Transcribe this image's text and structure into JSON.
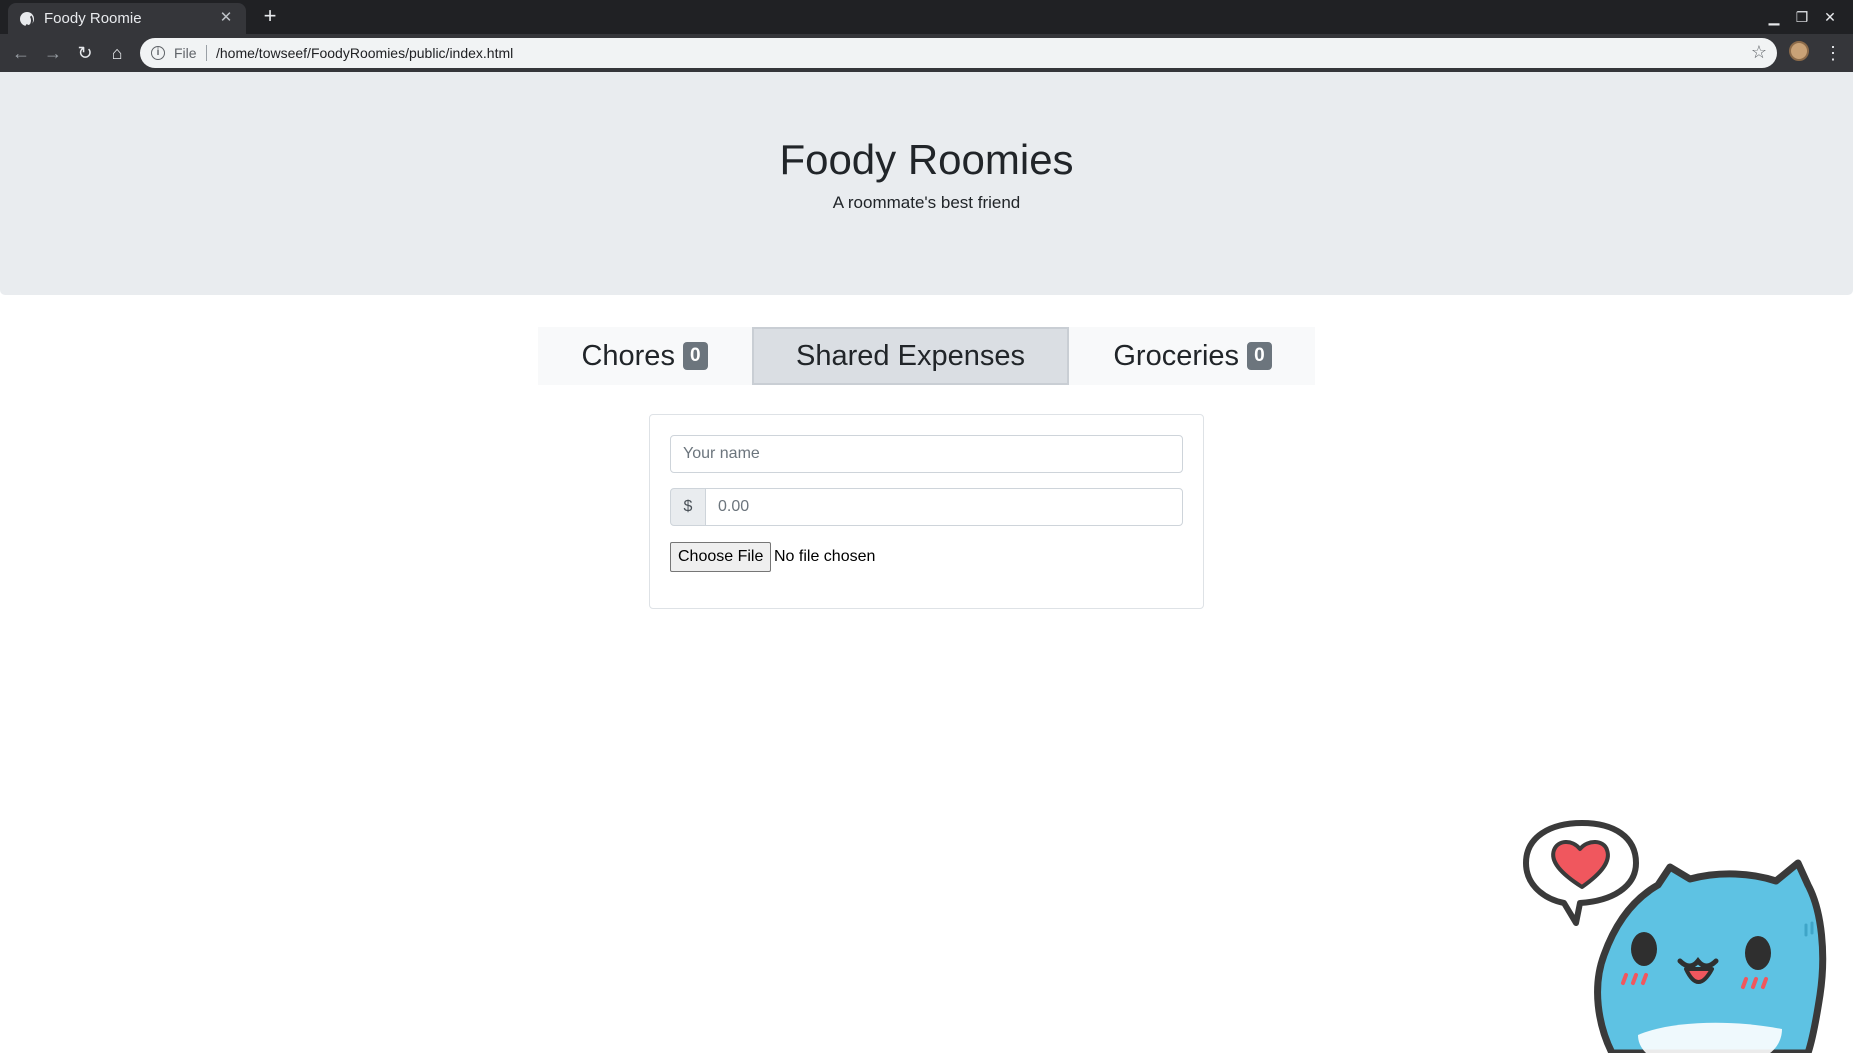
{
  "browser": {
    "tab_title": "Foody Roomie",
    "tab_close": "✕",
    "new_tab": "+",
    "scheme_label": "File",
    "url": "/home/towseef/FoodyRoomies/public/index.html",
    "icons": [
      "back-icon",
      "forward-icon",
      "reload-icon",
      "home-icon",
      "info-icon",
      "star-icon",
      "profile-icon",
      "menu-icon",
      "minimize-icon",
      "maximize-icon",
      "close-icon"
    ]
  },
  "header": {
    "title": "Foody Roomies",
    "subtitle": "A roommate's best friend"
  },
  "tabs": [
    {
      "label": "Chores",
      "badge": "0",
      "active": false
    },
    {
      "label": "Shared Expenses",
      "badge": "",
      "active": true
    },
    {
      "label": "Groceries",
      "badge": "0",
      "active": false
    }
  ],
  "form": {
    "name_placeholder": "Your name",
    "name_value": "",
    "currency_symbol": "$",
    "amount_placeholder": "0.00",
    "amount_value": "",
    "file_button": "Choose File",
    "file_status": "No file chosen"
  },
  "colors": {
    "jumbotron_bg": "#e9ecef",
    "active_tab_bg": "#dadee3",
    "badge_bg": "#6c757d",
    "mascot_blue": "#5ec2e3",
    "heart_red": "#f0575e"
  }
}
